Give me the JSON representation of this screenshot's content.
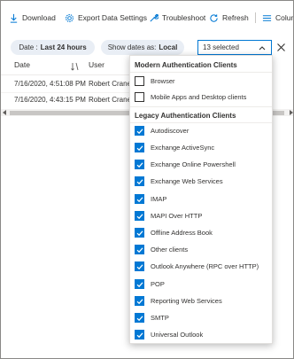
{
  "toolbar": {
    "download": "Download",
    "export": "Export Data Settings",
    "troubleshoot": "Troubleshoot",
    "refresh": "Refresh",
    "columns": "Colum"
  },
  "filters": {
    "date_label": "Date :",
    "date_value": "Last 24 hours",
    "show_dates_label": "Show dates as:",
    "show_dates_value": "Local",
    "selected_text": "13 selected"
  },
  "table": {
    "headers": {
      "date": "Date",
      "user": "User"
    },
    "rows": [
      {
        "date": "7/16/2020, 4:51:08 PM",
        "user": "Robert Crane"
      },
      {
        "date": "7/16/2020, 4:43:15 PM",
        "user": "Robert Crane"
      }
    ]
  },
  "dropdown": {
    "group_modern": "Modern Authentication Clients",
    "modern": [
      {
        "label": "Browser",
        "checked": false
      },
      {
        "label": "Mobile Apps and Desktop clients",
        "checked": false
      }
    ],
    "group_legacy": "Legacy Authentication Clients",
    "legacy": [
      {
        "label": "Autodiscover",
        "checked": true
      },
      {
        "label": "Exchange ActiveSync",
        "checked": true
      },
      {
        "label": "Exchange Online Powershell",
        "checked": true
      },
      {
        "label": "Exchange Web Services",
        "checked": true
      },
      {
        "label": "IMAP",
        "checked": true
      },
      {
        "label": "MAPI Over HTTP",
        "checked": true
      },
      {
        "label": "Offline Address Book",
        "checked": true
      },
      {
        "label": "Other clients",
        "checked": true
      },
      {
        "label": "Outlook Anywhere (RPC over HTTP)",
        "checked": true
      },
      {
        "label": "POP",
        "checked": true
      },
      {
        "label": "Reporting Web Services",
        "checked": true
      },
      {
        "label": "SMTP",
        "checked": true
      },
      {
        "label": "Universal Outlook",
        "checked": true
      }
    ]
  },
  "colors": {
    "accent": "#0078d4",
    "pill_bg": "#e9eef5",
    "text": "#323130"
  }
}
